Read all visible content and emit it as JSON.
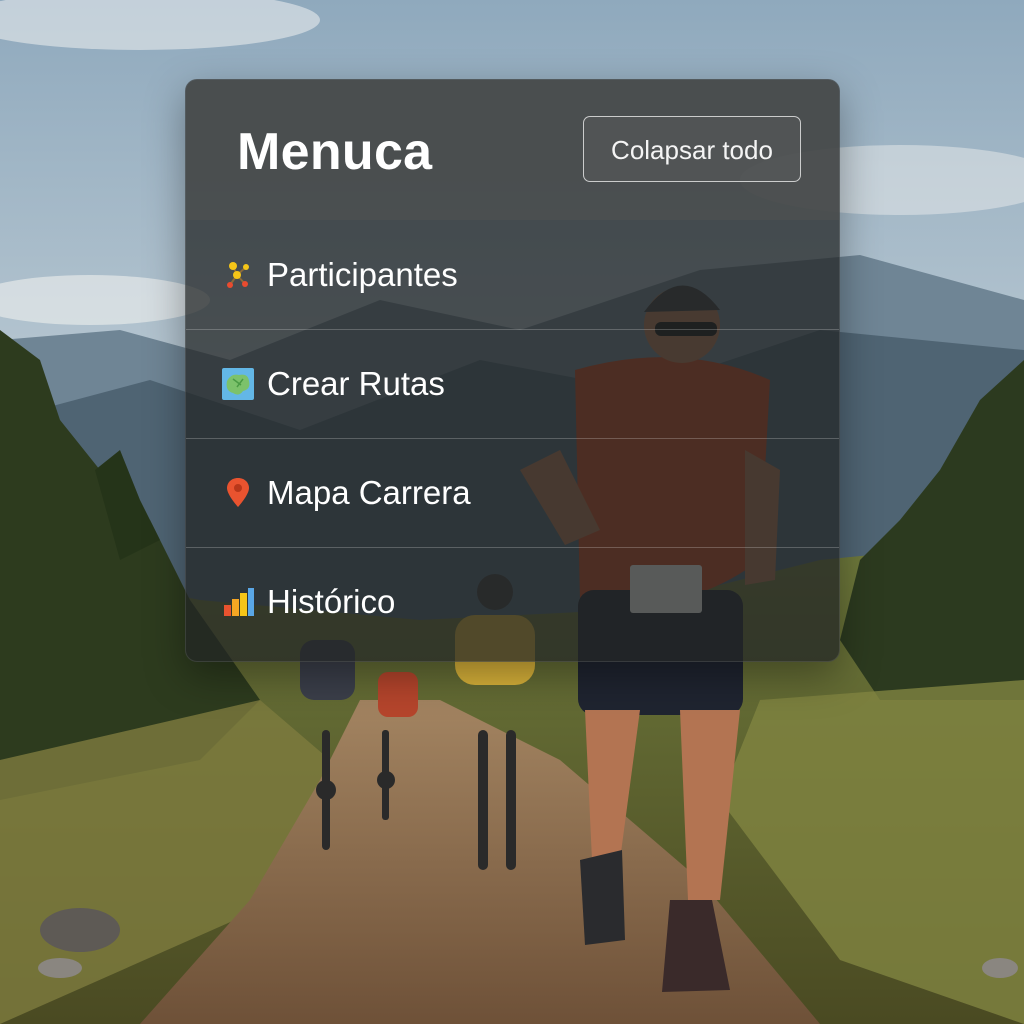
{
  "menu": {
    "title": "Menuca",
    "collapse_label": "Colapsar todo",
    "items": [
      {
        "label": "Participantes",
        "icon": "participants-icon"
      },
      {
        "label": "Crear Rutas",
        "icon": "map-icon"
      },
      {
        "label": "Mapa Carrera",
        "icon": "map-pin-icon"
      },
      {
        "label": "Histórico",
        "icon": "bar-chart-icon"
      }
    ]
  },
  "colors": {
    "panel": "#222424",
    "header": "#4e5050",
    "text": "#ffffff",
    "pin": "#e9532f"
  }
}
